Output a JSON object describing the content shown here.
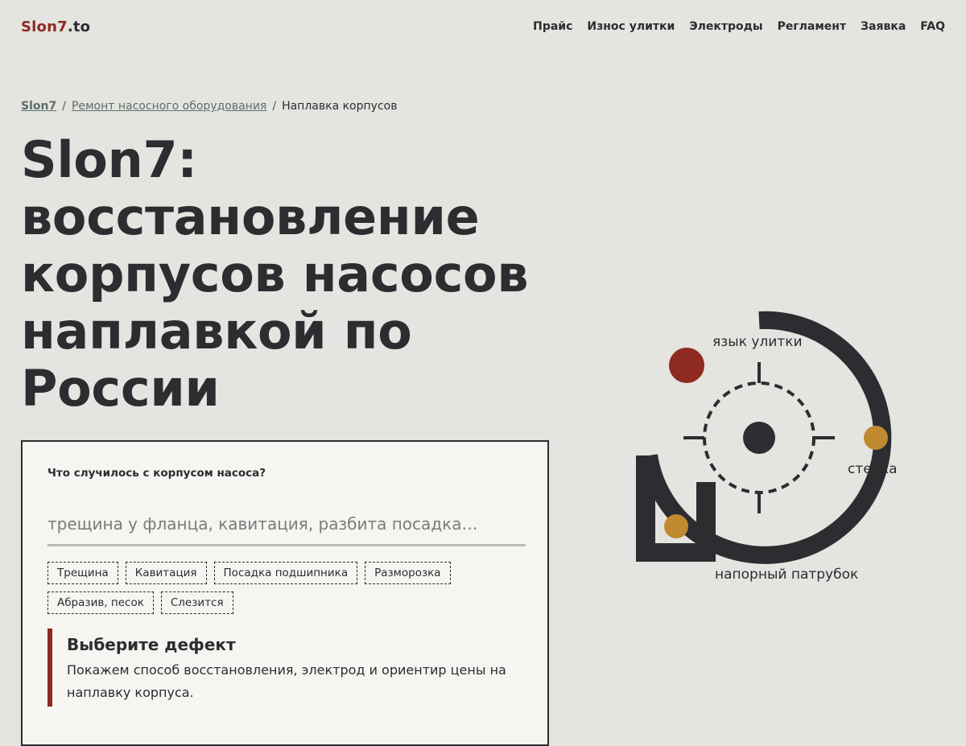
{
  "header": {
    "logo_brand": "Slon7",
    "logo_tld": ".to",
    "nav": [
      "Прайс",
      "Износ улитки",
      "Электроды",
      "Регламент",
      "Заявка",
      "FAQ"
    ]
  },
  "breadcrumb": {
    "home": "Slon7",
    "section": "Ремонт насосного оборудования",
    "current": "Наплавка корпусов",
    "separator": "/"
  },
  "hero": {
    "title_lines": [
      "Slon7:",
      "восстановление",
      "корпусов насосов",
      "наплавкой по",
      "России"
    ]
  },
  "form": {
    "label": "Что случилось с корпусом насоса?",
    "placeholder": "трещина у фланца, кавитация, разбита посадка…",
    "value": "",
    "chips": [
      "Трещина",
      "Кавитация",
      "Посадка подшипника",
      "Разморозка",
      "Абразив, песок",
      "Слезится"
    ]
  },
  "result": {
    "title": "Выберите дефект",
    "text": "Покажем способ восстановления, электрод и ориентир цены на наплавку корпуса."
  },
  "diagram": {
    "labels": {
      "tongue": "язык улитки",
      "wall": "стенка",
      "outlet": "напорный патрубок"
    },
    "colors": {
      "body": "#2b2d30",
      "critical": "#8e2a1f",
      "wear": "#c08a30"
    }
  }
}
